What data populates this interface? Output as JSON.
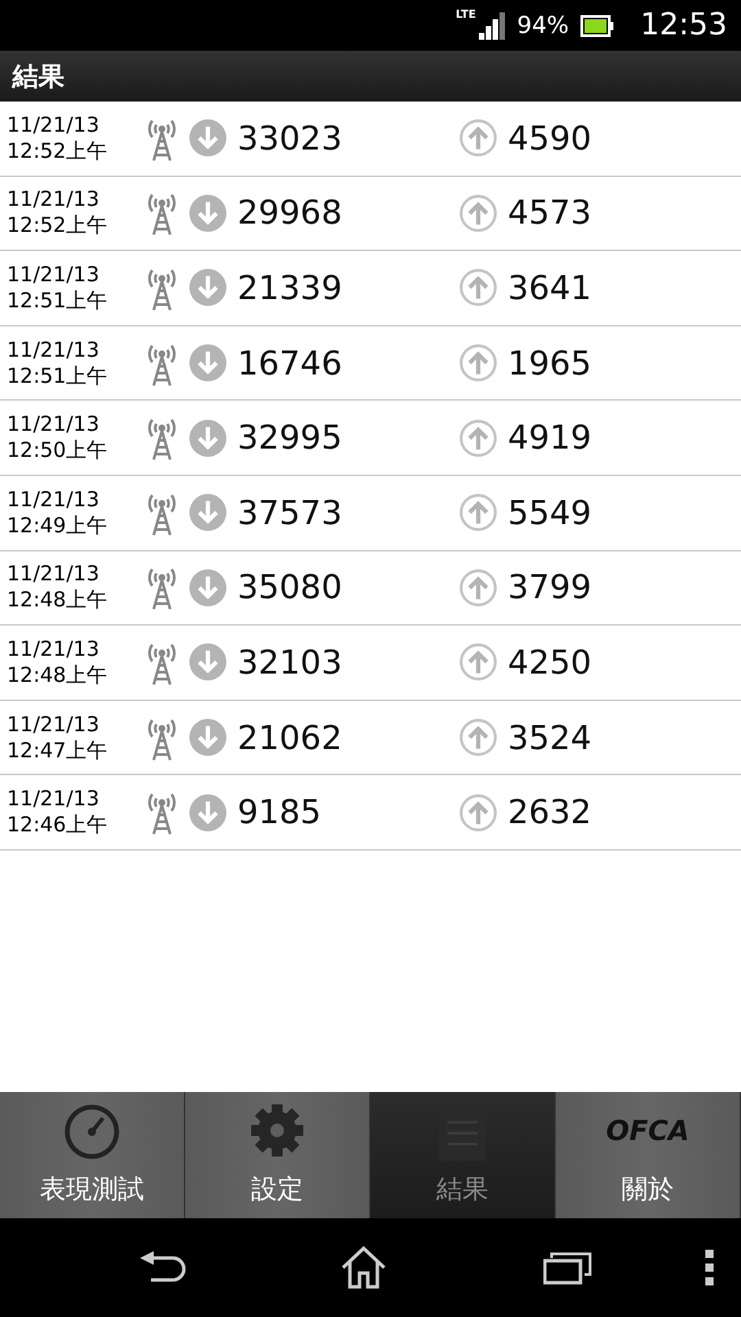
{
  "status_bar": {
    "network": "LTE",
    "battery": "94%",
    "time": "12:53"
  },
  "title": "結果",
  "results": [
    {
      "date": "11/21/13",
      "time": "12:52上午",
      "download": "33023",
      "upload": "4590"
    },
    {
      "date": "11/21/13",
      "time": "12:52上午",
      "download": "29968",
      "upload": "4573"
    },
    {
      "date": "11/21/13",
      "time": "12:51上午",
      "download": "21339",
      "upload": "3641"
    },
    {
      "date": "11/21/13",
      "time": "12:51上午",
      "download": "16746",
      "upload": "1965"
    },
    {
      "date": "11/21/13",
      "time": "12:50上午",
      "download": "32995",
      "upload": "4919"
    },
    {
      "date": "11/21/13",
      "time": "12:49上午",
      "download": "37573",
      "upload": "5549"
    },
    {
      "date": "11/21/13",
      "time": "12:48上午",
      "download": "35080",
      "upload": "3799"
    },
    {
      "date": "11/21/13",
      "time": "12:48上午",
      "download": "32103",
      "upload": "4250"
    },
    {
      "date": "11/21/13",
      "time": "12:47上午",
      "download": "21062",
      "upload": "3524"
    },
    {
      "date": "11/21/13",
      "time": "12:46上午",
      "download": "9185",
      "upload": "2632"
    }
  ],
  "tabs": [
    {
      "kind": "gauge",
      "label": "表現測試",
      "selected": false
    },
    {
      "kind": "gear",
      "label": "設定",
      "selected": false
    },
    {
      "kind": "document",
      "label": "結果",
      "selected": true
    },
    {
      "kind": "logo",
      "logo_text": "OFCA",
      "label": "關於",
      "selected": false
    }
  ]
}
